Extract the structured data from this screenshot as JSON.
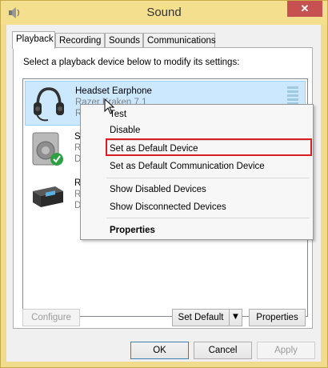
{
  "window": {
    "title": "Sound",
    "close_glyph": "✕",
    "title_color": "#f4df8f",
    "close_color": "#c75050"
  },
  "tabs": [
    {
      "label": "Playback",
      "active": true
    },
    {
      "label": "Recording",
      "active": false
    },
    {
      "label": "Sounds",
      "active": false
    },
    {
      "label": "Communications",
      "active": false
    }
  ],
  "playback": {
    "instruction": "Select a playback device below to modify its settings:",
    "devices": [
      {
        "name": "Headset Earphone",
        "description": "Razer Kraken 7.1",
        "status": "R",
        "icon": "headset-icon",
        "selected": true
      },
      {
        "name": "Sp",
        "description": "Re",
        "status": "D",
        "icon": "speaker-icon",
        "selected": false
      },
      {
        "name": "Re",
        "description": "Re",
        "status": "D",
        "icon": "receiver-icon",
        "selected": false
      }
    ],
    "configure_label": "Configure",
    "set_default_label": "Set Default",
    "properties_label": "Properties"
  },
  "context_menu": {
    "items": [
      {
        "label": "Test"
      },
      {
        "label": "Disable"
      },
      {
        "label": "Set as Default Device",
        "highlighted": true
      },
      {
        "label": "Set as Default Communication Device"
      },
      {
        "label": "Show Disabled Devices"
      },
      {
        "label": "Show Disconnected Devices"
      },
      {
        "label": "Properties",
        "bold": true
      }
    ],
    "highlight_color": "#d61f1f"
  },
  "dialog_buttons": {
    "ok": "OK",
    "cancel": "Cancel",
    "apply": "Apply"
  }
}
